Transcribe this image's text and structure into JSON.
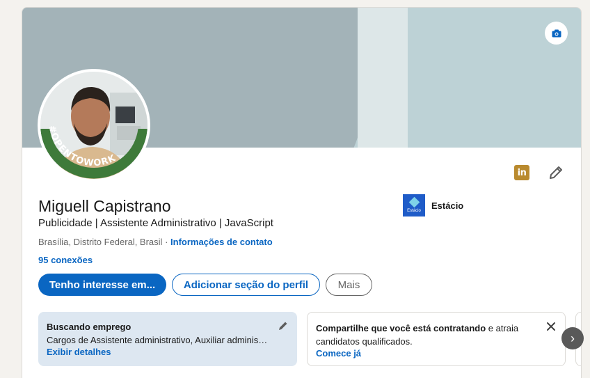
{
  "profile": {
    "name": "Miguell Capistrano",
    "headline": "Publicidade | Assistente Administrativo | JavaScript",
    "location": "Brasília, Distrito Federal, Brasil",
    "location_sep": " · ",
    "contact_link": "Informações de contato",
    "connections": "95 conexões",
    "open_to_work_badge": "#OPENTOWORK"
  },
  "education": {
    "logo_text": "Estácio",
    "name": "Estácio"
  },
  "icons": {
    "camera": "camera-icon",
    "linkedin": "linkedin-icon",
    "edit": "pencil-icon",
    "close": "close-icon",
    "next": "chevron-right-icon"
  },
  "linkedin_icon_text": "in",
  "actions": {
    "primary": "Tenho interesse em...",
    "add_section": "Adicionar seção do perfil",
    "more": "Mais"
  },
  "job_card": {
    "title": "Buscando emprego",
    "description": "Cargos de Assistente administrativo, Auxiliar administrativo",
    "link": "Exibir detalhes"
  },
  "hire_card": {
    "bold_text": "Compartilhe que você está contratando",
    "rest_text": " e atraia candidatos qualificados.",
    "link": "Comece já"
  },
  "carousel_next": "›",
  "colors": {
    "brand_blue": "#0a66c2",
    "open_to_work_green": "#3e7a3a",
    "banner_light": "#bdd2d6",
    "banner_dark": "#a3b3b8"
  }
}
